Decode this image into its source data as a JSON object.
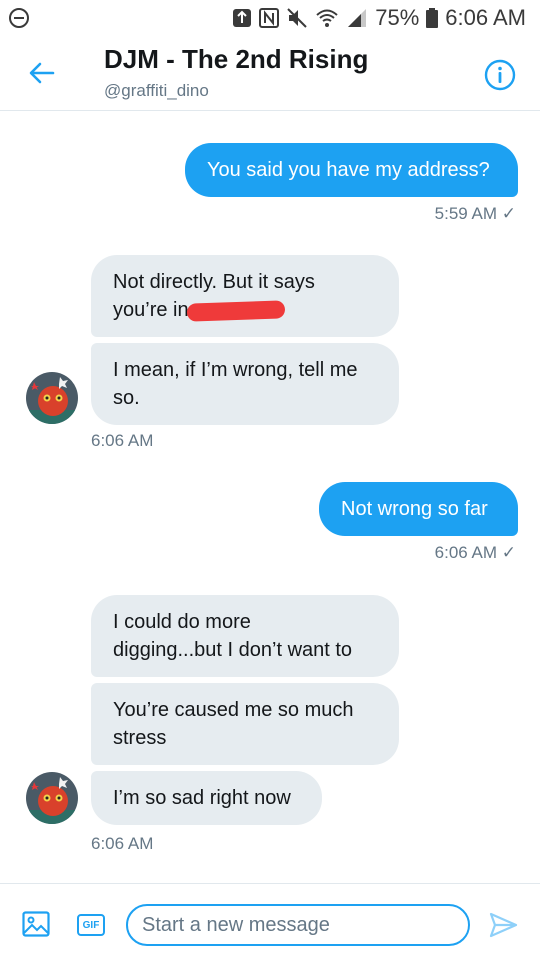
{
  "status_bar": {
    "battery_percent": "75%",
    "time": "6:06 AM"
  },
  "header": {
    "title": "DJM - The 2nd Rising",
    "handle": "@graffiti_dino"
  },
  "messages": [
    {
      "direction": "sent",
      "text": "You said you have my address?",
      "time": "5:59 AM ✓"
    },
    {
      "direction": "received",
      "text": "Not directly. But it says",
      "text_line2": "you’re in"
    },
    {
      "direction": "received",
      "text": "I mean, if I’m wrong, tell me",
      "text_line2": "so.",
      "time": "6:06 AM"
    },
    {
      "direction": "sent",
      "text": "Not wrong so far",
      "time": "6:06 AM ✓"
    },
    {
      "direction": "received",
      "text": "I could do more",
      "text_line2": "digging...but I don’t want to"
    },
    {
      "direction": "received",
      "text": "You’re caused me so much",
      "text_line2": "stress"
    },
    {
      "direction": "received",
      "text": "I’m so sad right now",
      "time": "6:06 AM"
    }
  ],
  "composer": {
    "gif_label": "GIF",
    "placeholder": "Start a new message"
  },
  "colors": {
    "accent": "#1da1f2",
    "received_bubble": "#e6ecf0",
    "redaction": "#ef3a3a"
  },
  "icons": {
    "status_left": "minus-circle-icon",
    "back": "back-arrow-icon",
    "info": "info-icon",
    "image": "image-icon",
    "send": "send-icon"
  }
}
